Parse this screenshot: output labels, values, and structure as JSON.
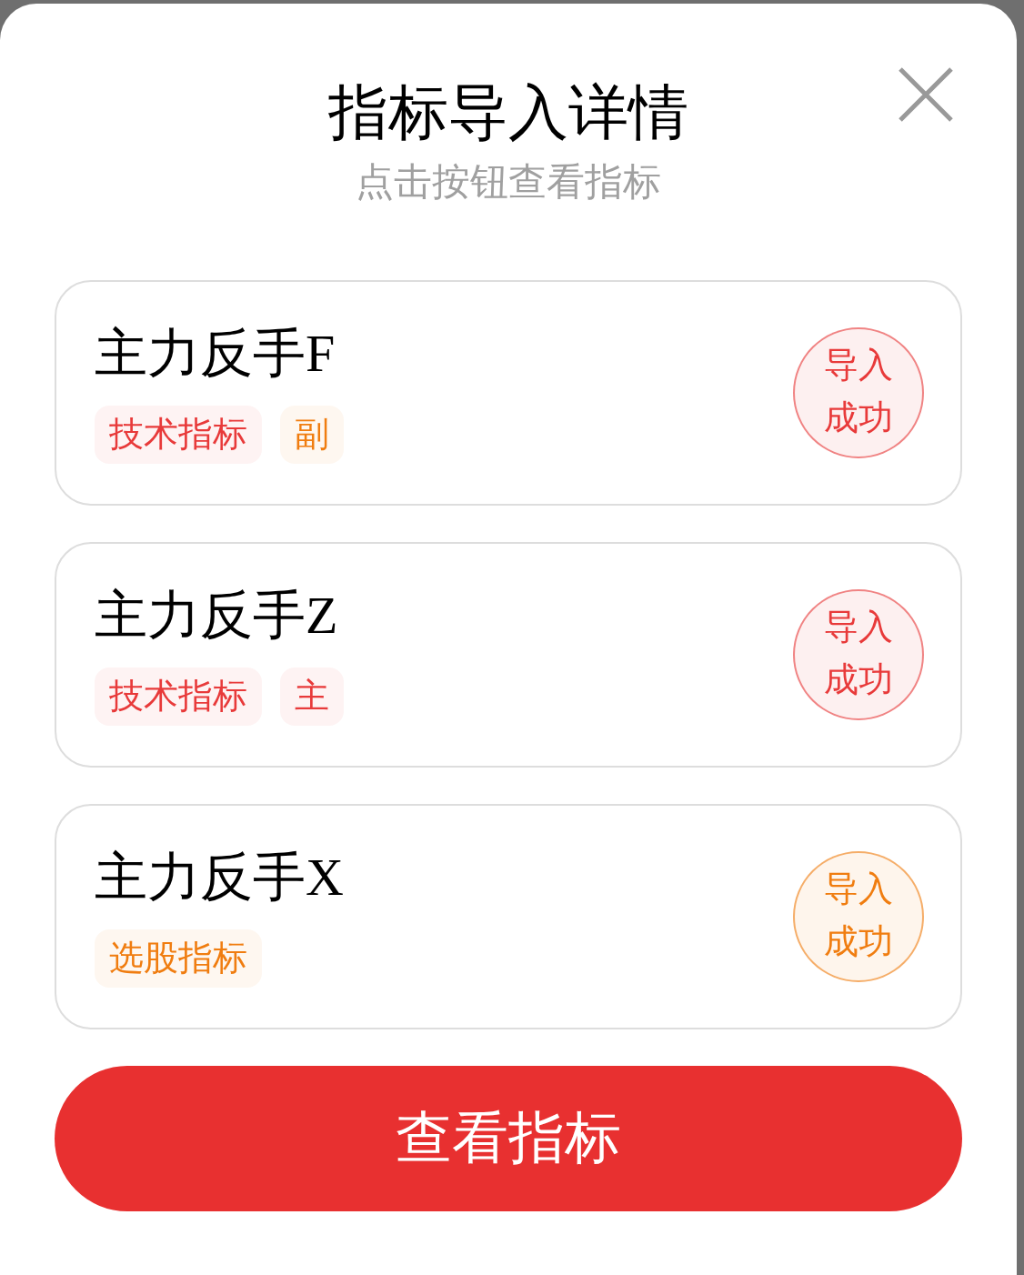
{
  "dialog": {
    "title": "指标导入详情",
    "subtitle": "点击按钮查看指标"
  },
  "items": [
    {
      "name": "主力反手F",
      "tags": [
        {
          "label": "技术指标",
          "color": "#e83a3a"
        },
        {
          "label": "副",
          "color": "#f07d10"
        }
      ],
      "status": {
        "label": "导入成功",
        "color": "#e83a3a"
      }
    },
    {
      "name": "主力反手Z",
      "tags": [
        {
          "label": "技术指标",
          "color": "#e83a3a"
        },
        {
          "label": "主",
          "color": "#e83a3a"
        }
      ],
      "status": {
        "label": "导入成功",
        "color": "#e83a3a"
      }
    },
    {
      "name": "主力反手X",
      "tags": [
        {
          "label": "选股指标",
          "color": "#f07d10"
        }
      ],
      "status": {
        "label": "导入成功",
        "color": "#f07d10"
      }
    }
  ],
  "button": {
    "label": "查看指标"
  }
}
